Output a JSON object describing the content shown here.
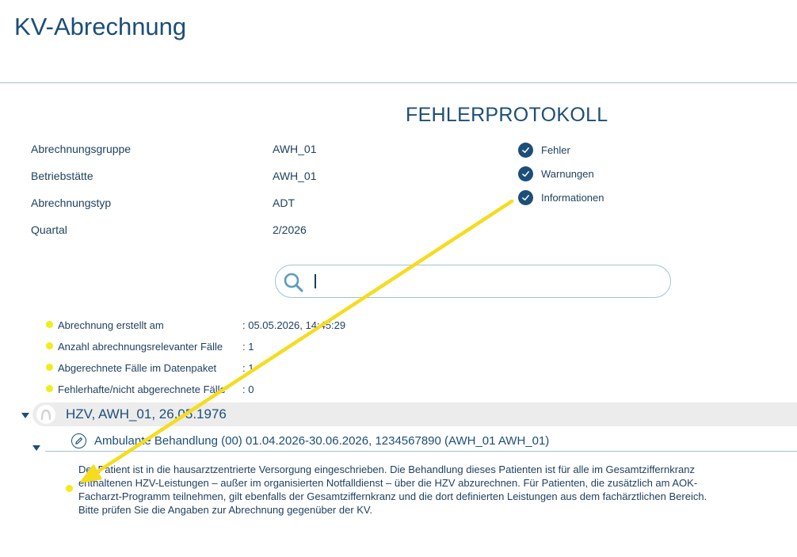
{
  "app": {
    "title": "KV-Abrechnung"
  },
  "protocol": {
    "title": "FEHLERPROTOKOLL"
  },
  "info": [
    {
      "label": "Abrechnungsgruppe",
      "value": "AWH_01"
    },
    {
      "label": "Betriebstätte",
      "value": "AWH_01"
    },
    {
      "label": "Abrechnungstyp",
      "value": "ADT"
    },
    {
      "label": "Quartal",
      "value": "2/2026"
    }
  ],
  "filters": [
    {
      "label": "Fehler",
      "checked": true
    },
    {
      "label": "Warnungen",
      "checked": true
    },
    {
      "label": "Informationen",
      "checked": true
    }
  ],
  "search": {
    "value": "",
    "icon": "search-icon"
  },
  "stats": [
    {
      "label": "Abrechnung erstellt am",
      "value": ": 05.05.2026, 14:45:29"
    },
    {
      "label": "Anzahl abrechnungsrelevanter Fälle",
      "value": ": 1"
    },
    {
      "label": "Abgerechnete Fälle im Datenpaket",
      "value": ": 1"
    },
    {
      "label": "Fehlerhafte/nicht abgerechnete Fälle",
      "value": ": 0"
    }
  ],
  "patient": {
    "title": "HZV, AWH_01, 26.05.1976",
    "icon": "patient-avatar-icon"
  },
  "case": {
    "title": "Ambulante Behandlung (00) 01.04.2026-30.06.2026, 1234567890 (AWH_01 AWH_01)",
    "icon": "edit-icon"
  },
  "message": {
    "text": "Der Patient ist in die hausarztzentrierte Versorgung eingeschrieben. Die Behandlung dieses Patienten ist für alle im Gesamtziffernkranz enthaltenen HZV-Leistungen – außer im organisierten Notfalldienst – über die HZV abzurechnen. Für Patienten, die zusätzlich am AOK-Facharzt-Programm teilnehmen, gilt ebenfalls der Gesamtziffernkranz und die dort definierten Leistungen aus dem fachärztlichen Bereich. Bitte prüfen Sie die Angaben zur Abrechnung gegenüber der KV."
  },
  "colors": {
    "accent": "#1c4e78",
    "highlight": "#f2ec17",
    "annotation_arrow": "#f5dc1f",
    "rule": "#9fc3d3"
  }
}
